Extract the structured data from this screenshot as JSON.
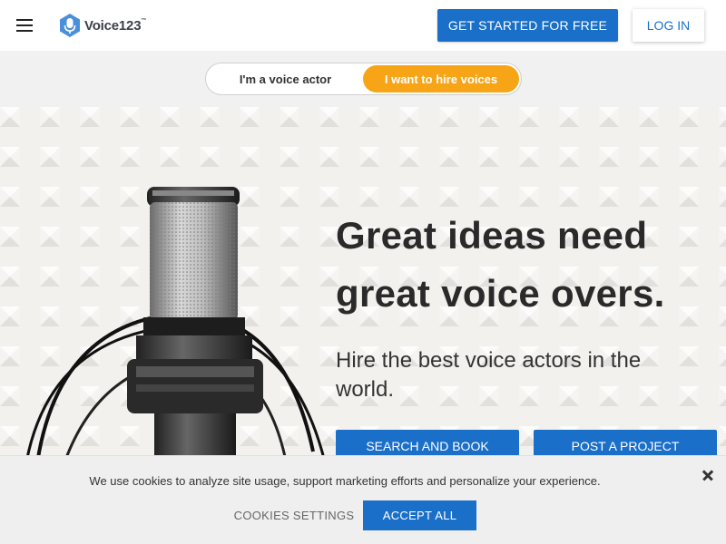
{
  "header": {
    "menu_icon": "hamburger-menu-icon",
    "logo_text": "Voice123",
    "logo_tm": "™",
    "get_started_label": "GET STARTED FOR FREE",
    "login_label": "LOG IN"
  },
  "toggle": {
    "actor_label": "I'm a voice actor",
    "hire_label": "I want to hire voices",
    "selected": "hire"
  },
  "hero": {
    "title_line1": "Great ideas need",
    "title_line2": "great voice overs.",
    "subtitle": "Hire the best voice actors in the world.",
    "search_label": "SEARCH AND BOOK",
    "post_label": "POST A PROJECT"
  },
  "cookie": {
    "text": "We use cookies to analyze site usage, support marketing efforts and personalize your experience.",
    "settings_label": "COOKIES SETTINGS",
    "accept_label": "ACCEPT ALL"
  },
  "colors": {
    "brand_blue": "#1a6fc9",
    "accent_orange": "#f7a416",
    "logo_blue": "#4a90d9"
  }
}
